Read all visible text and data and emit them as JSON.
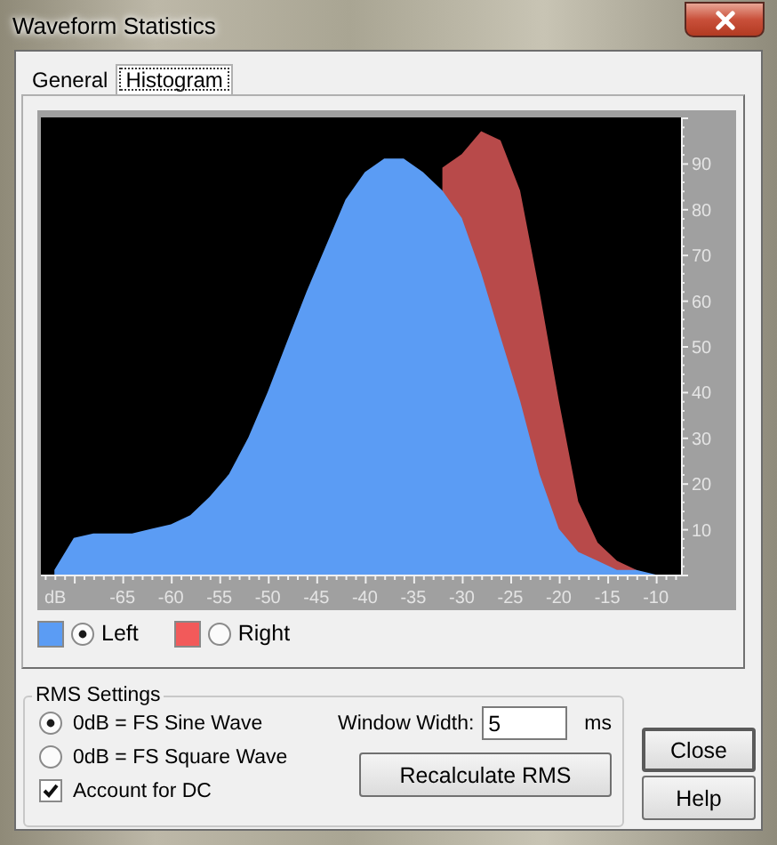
{
  "window": {
    "title": "Waveform Statistics"
  },
  "tabs": [
    {
      "label": "General",
      "selected": false
    },
    {
      "label": "Histogram",
      "selected": true
    }
  ],
  "histogram": {
    "chart_data": {
      "type": "area",
      "xlabel": "dB",
      "x": [
        -72,
        -70,
        -68,
        -66,
        -64,
        -62,
        -60,
        -58,
        -56,
        -54,
        -52,
        -50,
        -48,
        -46,
        -44,
        -42,
        -40,
        -38,
        -36,
        -34,
        -32,
        -30,
        -28,
        -26,
        -24,
        -22,
        -20,
        -18,
        -16,
        -14,
        -12,
        -10,
        -8
      ],
      "series": [
        {
          "name": "Left",
          "color": "#5b9cf4",
          "values": [
            1,
            8,
            9,
            9,
            9,
            10,
            11,
            13,
            17,
            22,
            30,
            40,
            51,
            62,
            72,
            82,
            88,
            91,
            91,
            88,
            84,
            78,
            66,
            52,
            38,
            22,
            10,
            5,
            3,
            1,
            1,
            0,
            0
          ]
        },
        {
          "name": "Right",
          "color": "#b84a4a",
          "values": [
            null,
            null,
            null,
            null,
            null,
            null,
            null,
            null,
            null,
            null,
            null,
            null,
            null,
            null,
            null,
            null,
            null,
            null,
            null,
            null,
            89,
            92,
            97,
            95,
            84,
            62,
            38,
            16,
            7,
            3,
            1,
            null,
            null
          ]
        }
      ],
      "xlim": [
        -73.4,
        -7.4
      ],
      "ylim": [
        0,
        100
      ],
      "xticks": [
        -65,
        -60,
        -55,
        -50,
        -45,
        -40,
        -35,
        -30,
        -25,
        -20,
        -15,
        -10
      ],
      "yticks": [
        10,
        20,
        30,
        40,
        50,
        60,
        70,
        80,
        90
      ],
      "stacked": false
    }
  },
  "legend": [
    {
      "color": "#5b9cf4",
      "selected": true
    },
    {
      "color": "#f25a5a",
      "selected": false
    }
  ],
  "rms_settings": {
    "title": "RMS Settings",
    "options": [
      {
        "label": "0dB = FS Sine Wave",
        "selected": true
      },
      {
        "label": "0dB = FS Square Wave",
        "selected": false
      }
    ],
    "account_for_dc": {
      "label": "Account for DC",
      "checked": true
    },
    "window_width": {
      "label": "Window Width:",
      "value": "5",
      "unit": "ms"
    },
    "recalculate_button": "Recalculate RMS"
  },
  "buttons": [
    "Close",
    "Help"
  ]
}
